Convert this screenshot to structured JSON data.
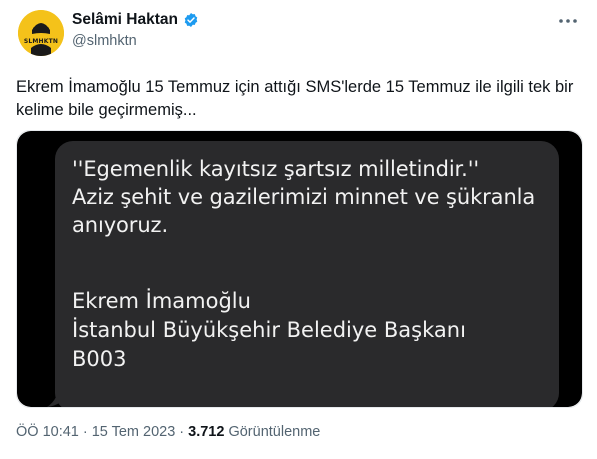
{
  "author": {
    "display_name": "Selâmi Haktan",
    "handle": "@slmhktn",
    "avatar_text": "SLMHKTN",
    "verified_icon": "verified-badge-icon",
    "verified_color": "#1d9bf0",
    "avatar_color": "#f4c21a"
  },
  "tweet": {
    "text": "Ekrem İmamoğlu 15 Temmuz için attığı SMS'lerde 15 Temmuz ile ilgili tek bir kelime bile geçirmemiş..."
  },
  "sms": {
    "body": "''Egemenlik kayıtsız şartsız milletindir.''\nAziz şehit ve gazilerimizi minnet ve şükranla anıyoruz.",
    "signature_name": "Ekrem İmamoğlu",
    "signature_title": "İstanbul Büyükşehir Belediye Başkanı",
    "signature_code": "B003",
    "bubble_color": "#2a2a2c"
  },
  "meta": {
    "time": "ÖÖ 10:41",
    "date": "15 Tem 2023",
    "views_count": "3.712",
    "views_label": "Görüntülenme",
    "separator": "·"
  },
  "menu_icon": "more-horizontal-icon"
}
